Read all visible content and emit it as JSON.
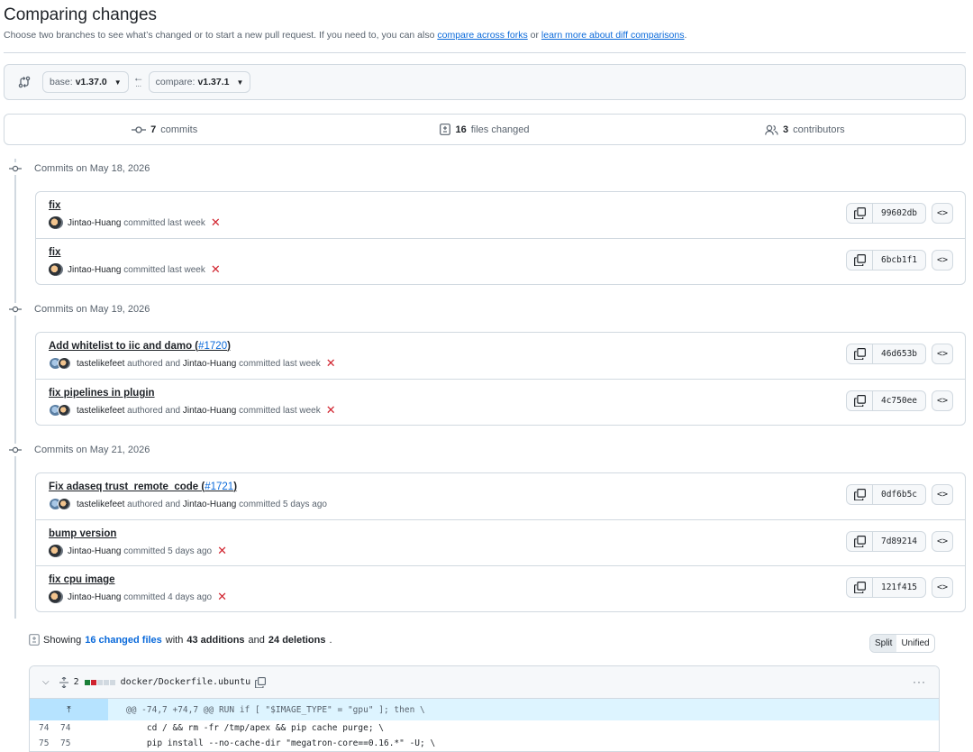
{
  "header": {
    "title": "Comparing changes",
    "subtitle_pre": "Choose two branches to see what’s changed or to start a new pull request. If you need to, you can also",
    "link_forks": "compare across forks",
    "subtitle_or": "or",
    "link_learn": "learn more about diff comparisons",
    "subtitle_end": "."
  },
  "range": {
    "base_prefix": "base:",
    "base_value": "v1.37.0",
    "compare_prefix": "compare:",
    "compare_value": "v1.37.1",
    "arrow": "←",
    "ellipsis": "..."
  },
  "stats": {
    "commits_count": "7",
    "commits_label": "commits",
    "files_count": "16",
    "files_label": "files changed",
    "contributors_count": "3",
    "contributors_label": "contributors"
  },
  "groups": [
    {
      "date_label": "Commits on May 18, 2026",
      "commits": [
        {
          "message": "fix",
          "pr": "",
          "author1": "Jintao-Huang",
          "mid": "",
          "author2": "",
          "action": "committed last week",
          "sha": "99602db",
          "failed": true
        },
        {
          "message": "fix",
          "pr": "",
          "author1": "Jintao-Huang",
          "mid": "",
          "author2": "",
          "action": "committed last week",
          "sha": "6bcb1f1",
          "failed": true
        }
      ]
    },
    {
      "date_label": "Commits on May 19, 2026",
      "commits": [
        {
          "message": "Add whitelist to iic and damo (",
          "pr": "#1720",
          "msg_end": ")",
          "author1": "tastelikefeet",
          "mid": "authored and",
          "author2": "Jintao-Huang",
          "action": "committed last week",
          "sha": "46d653b",
          "failed": true
        },
        {
          "message": "fix pipelines in plugin",
          "pr": "",
          "author1": "tastelikefeet",
          "mid": "authored and",
          "author2": "Jintao-Huang",
          "action": "committed last week",
          "sha": "4c750ee",
          "failed": true
        }
      ]
    },
    {
      "date_label": "Commits on May 21, 2026",
      "commits": [
        {
          "message": "Fix adaseq trust_remote_code (",
          "pr": "#1721",
          "msg_end": ")",
          "author1": "tastelikefeet",
          "mid": "authored and",
          "author2": "Jintao-Huang",
          "action": "committed 5 days ago",
          "sha": "0df6b5c",
          "failed": false
        },
        {
          "message": "bump version",
          "pr": "",
          "author1": "Jintao-Huang",
          "mid": "",
          "author2": "",
          "action": "committed 5 days ago",
          "sha": "7d89214",
          "failed": true
        },
        {
          "message": "fix cpu image",
          "pr": "",
          "author1": "Jintao-Huang",
          "mid": "",
          "author2": "",
          "action": "committed 4 days ago",
          "sha": "121f415",
          "failed": true
        }
      ]
    }
  ],
  "summary": {
    "showing": "Showing",
    "changed_files": "16 changed files",
    "with": "with",
    "additions": "43 additions",
    "and": "and",
    "deletions": "24 deletions",
    "end": "."
  },
  "view": {
    "split": "Split",
    "unified": "Unified"
  },
  "file": {
    "changes": "2",
    "path": "docker/Dockerfile.ubuntu",
    "more": "···",
    "hunk": "@@ -74,7 +74,7 @@ RUN if [ \"$IMAGE_TYPE\" = \"gpu\" ]; then \\",
    "lines": [
      {
        "old": "74",
        "new": "74",
        "code": "    cd / && rm -fr /tmp/apex && pip cache purge; \\"
      },
      {
        "old": "75",
        "new": "75",
        "code": "    pip install --no-cache-dir \"megatron-core==0.16.*\" -U; \\"
      }
    ]
  },
  "colors": {
    "accent": "#0969da",
    "danger": "#d1242f",
    "added": "#1a7f37",
    "removed": "#cf222e"
  }
}
